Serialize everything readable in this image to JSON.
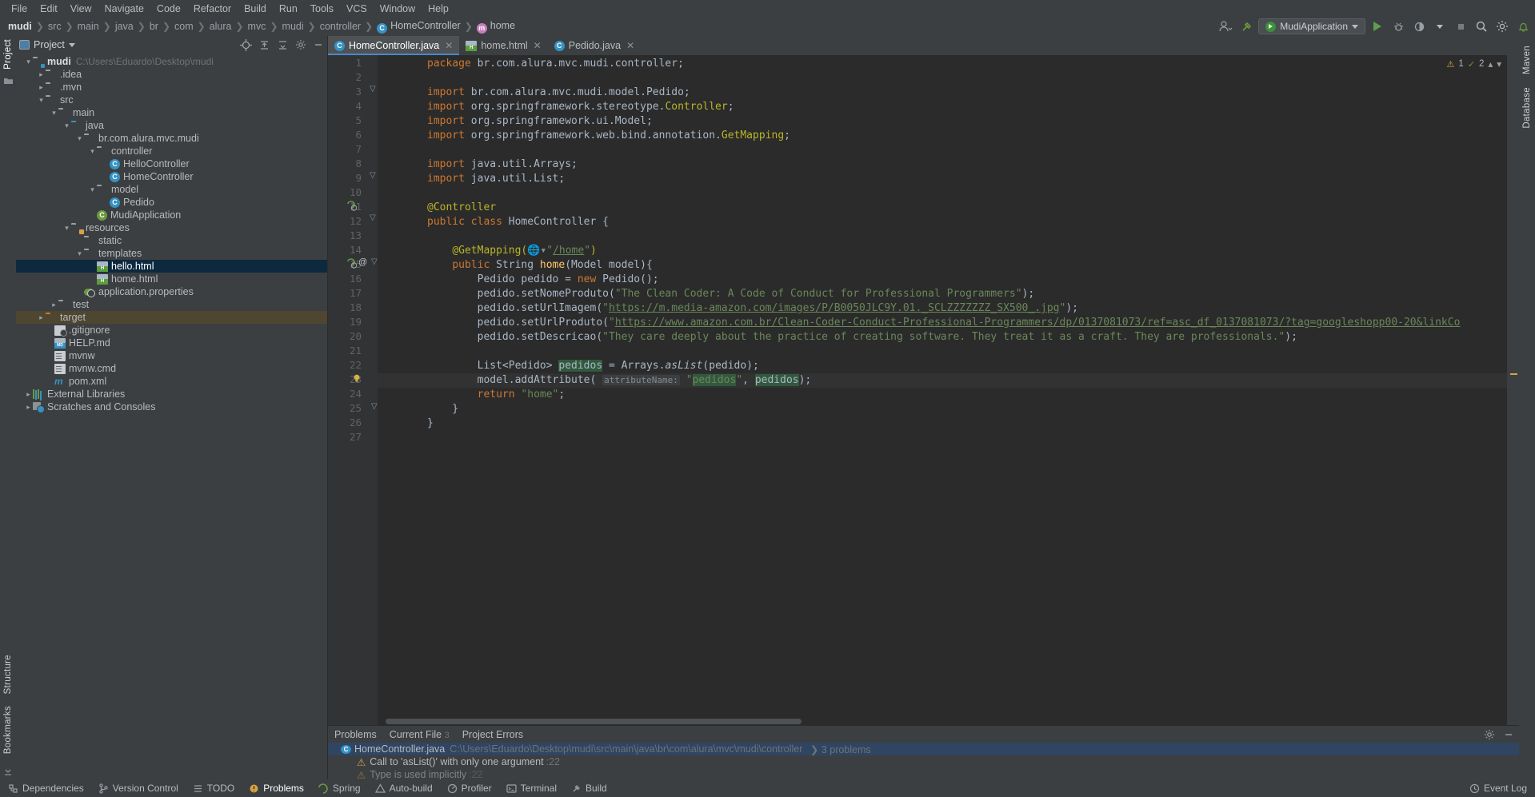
{
  "menu": {
    "items": [
      "File",
      "Edit",
      "View",
      "Navigate",
      "Code",
      "Refactor",
      "Build",
      "Run",
      "Tools",
      "VCS",
      "Window",
      "Help"
    ]
  },
  "breadcrumb": {
    "items": [
      "mudi",
      "src",
      "main",
      "java",
      "br",
      "com",
      "alura",
      "mvc",
      "mudi",
      "controller",
      "HomeController",
      "home"
    ],
    "class_glyph": "C",
    "method_glyph": "m"
  },
  "toolbar": {
    "run_config": "MudiApplication",
    "search_icon": "search-icon",
    "settings_icon": "gear-icon"
  },
  "project_panel": {
    "title": "Project",
    "vertical_tab": "Project",
    "structure_tab": "Structure",
    "bookmarks_tab": "Bookmarks",
    "tree": [
      {
        "label": "mudi",
        "path": "C:\\Users\\Eduardo\\Desktop\\mudi",
        "indent": 0,
        "arrow": "v",
        "icon": "module",
        "bold": true
      },
      {
        "label": ".idea",
        "indent": 1,
        "arrow": ">",
        "icon": "folder"
      },
      {
        "label": ".mvn",
        "indent": 1,
        "arrow": ">",
        "icon": "folder"
      },
      {
        "label": "src",
        "indent": 1,
        "arrow": "v",
        "icon": "folder"
      },
      {
        "label": "main",
        "indent": 2,
        "arrow": "v",
        "icon": "folder"
      },
      {
        "label": "java",
        "indent": 3,
        "arrow": "v",
        "icon": "folder-src"
      },
      {
        "label": "br.com.alura.mvc.mudi",
        "indent": 4,
        "arrow": "v",
        "icon": "package"
      },
      {
        "label": "controller",
        "indent": 5,
        "arrow": "v",
        "icon": "package"
      },
      {
        "label": "HelloController",
        "indent": 6,
        "arrow": "",
        "icon": "class"
      },
      {
        "label": "HomeController",
        "indent": 6,
        "arrow": "",
        "icon": "class"
      },
      {
        "label": "model",
        "indent": 5,
        "arrow": "v",
        "icon": "package"
      },
      {
        "label": "Pedido",
        "indent": 6,
        "arrow": "",
        "icon": "class"
      },
      {
        "label": "MudiApplication",
        "indent": 5,
        "arrow": "",
        "icon": "spring-class"
      },
      {
        "label": "resources",
        "indent": 3,
        "arrow": "v",
        "icon": "folder-res"
      },
      {
        "label": "static",
        "indent": 4,
        "arrow": "",
        "icon": "folder"
      },
      {
        "label": "templates",
        "indent": 4,
        "arrow": "v",
        "icon": "folder"
      },
      {
        "label": "hello.html",
        "indent": 5,
        "arrow": "",
        "icon": "html",
        "selected": true
      },
      {
        "label": "home.html",
        "indent": 5,
        "arrow": "",
        "icon": "html"
      },
      {
        "label": "application.properties",
        "indent": 4,
        "arrow": "",
        "icon": "spring-props"
      },
      {
        "label": "test",
        "indent": 2,
        "arrow": ">",
        "icon": "folder"
      },
      {
        "label": "target",
        "indent": 1,
        "arrow": ">",
        "icon": "folder-excluded",
        "highlighted": true
      },
      {
        "label": ".gitignore",
        "indent": 1,
        "arrow": "",
        "icon": "gitignore"
      },
      {
        "label": "HELP.md",
        "indent": 1,
        "arrow": "",
        "icon": "markdown"
      },
      {
        "label": "mvnw",
        "indent": 1,
        "arrow": "",
        "icon": "document"
      },
      {
        "label": "mvnw.cmd",
        "indent": 1,
        "arrow": "",
        "icon": "document"
      },
      {
        "label": "pom.xml",
        "indent": 1,
        "arrow": "",
        "icon": "maven"
      },
      {
        "label": "External Libraries",
        "indent": 0,
        "arrow": ">",
        "icon": "libraries"
      },
      {
        "label": "Scratches and Consoles",
        "indent": 0,
        "arrow": ">",
        "icon": "scratches"
      }
    ]
  },
  "editor": {
    "tabs": [
      {
        "label": "HomeController.java",
        "icon": "java-class-icon",
        "active": true
      },
      {
        "label": "home.html",
        "icon": "html-file-icon",
        "active": false
      },
      {
        "label": "Pedido.java",
        "icon": "java-class-icon",
        "active": false
      }
    ],
    "inspection_widget": {
      "warnings": "1",
      "checks": "2"
    },
    "lines": [
      {
        "n": 1,
        "text": "package br.com.alura.mvc.mudi.controller;"
      },
      {
        "n": 2,
        "text": ""
      },
      {
        "n": 3,
        "text": "import br.com.alura.mvc.mudi.model.Pedido;"
      },
      {
        "n": 4,
        "text": "import org.springframework.stereotype.Controller;"
      },
      {
        "n": 5,
        "text": "import org.springframework.ui.Model;"
      },
      {
        "n": 6,
        "text": "import org.springframework.web.bind.annotation.GetMapping;"
      },
      {
        "n": 7,
        "text": ""
      },
      {
        "n": 8,
        "text": "import java.util.Arrays;"
      },
      {
        "n": 9,
        "text": "import java.util.List;"
      },
      {
        "n": 10,
        "text": ""
      },
      {
        "n": 11,
        "text": "@Controller"
      },
      {
        "n": 12,
        "text": "public class HomeController {"
      },
      {
        "n": 13,
        "text": ""
      },
      {
        "n": 14,
        "text": "    @GetMapping(\"/home\")"
      },
      {
        "n": 15,
        "text": "    public String home(Model model){"
      },
      {
        "n": 16,
        "text": "        Pedido pedido = new Pedido();"
      },
      {
        "n": 17,
        "text": "        pedido.setNomeProduto(\"The Clean Coder: A Code of Conduct for Professional Programmers\");"
      },
      {
        "n": 18,
        "text": "        pedido.setUrlImagem(\"https://m.media-amazon.com/images/P/B0050JLC9Y.01._SCLZZZZZZZ_SX500_.jpg\");"
      },
      {
        "n": 19,
        "text": "        pedido.setUrlProduto(\"https://www.amazon.com.br/Clean-Coder-Conduct-Professional-Programmers/dp/0137081073/ref=asc_df_0137081073/?tag=googleshopp00-20&linkCo"
      },
      {
        "n": 20,
        "text": "        pedido.setDescricao(\"They care deeply about the practice of creating software. They treat it as a craft. They are professionals.\");"
      },
      {
        "n": 21,
        "text": ""
      },
      {
        "n": 22,
        "text": "        List<Pedido> pedidos = Arrays.asList(pedido);"
      },
      {
        "n": 23,
        "text": "        model.addAttribute( attributeName: \"pedidos\", pedidos);"
      },
      {
        "n": 24,
        "text": "        return \"home\";"
      },
      {
        "n": 25,
        "text": "    }"
      },
      {
        "n": 26,
        "text": "}"
      },
      {
        "n": 27,
        "text": ""
      }
    ],
    "param_hint": "attributeName:"
  },
  "problems": {
    "tabs": [
      {
        "label": "Problems",
        "count": ""
      },
      {
        "label": "Current File",
        "count": "3"
      },
      {
        "label": "Project Errors",
        "count": ""
      }
    ],
    "file_row": {
      "name": "HomeController.java",
      "path": "C:\\Users\\Eduardo\\Desktop\\mudi\\src\\main\\java\\br\\com\\alura\\mvc\\mudi\\controller",
      "count": "3 problems"
    },
    "rows": [
      {
        "severity": "warning",
        "text": "Call to 'asList()' with only one argument",
        "line": ":22"
      },
      {
        "severity": "warning",
        "text": "Type is used implicitly",
        "line": ":22"
      }
    ]
  },
  "statusbar": {
    "left": [
      {
        "label": "Dependencies",
        "icon": "dependencies-icon"
      },
      {
        "label": "Version Control",
        "icon": "branch-icon"
      },
      {
        "label": "TODO",
        "icon": "todo-icon"
      },
      {
        "label": "Problems",
        "icon": "problems-icon",
        "active": true
      },
      {
        "label": "Spring",
        "icon": "spring-icon"
      },
      {
        "label": "Auto-build",
        "icon": "autobuild-icon"
      },
      {
        "label": "Profiler",
        "icon": "profiler-icon"
      },
      {
        "label": "Terminal",
        "icon": "terminal-icon"
      },
      {
        "label": "Build",
        "icon": "build-icon"
      }
    ],
    "right": {
      "label": "Event Log",
      "icon": "event-log-icon"
    }
  },
  "right_strip": {
    "items": [
      "Maven",
      "Database"
    ]
  },
  "colors": {
    "accent": "#4a88c7",
    "selection": "#0d293e",
    "excluded": "#4e4630",
    "editor_bg": "#2b2b2b",
    "panel_bg": "#3c3f41"
  }
}
